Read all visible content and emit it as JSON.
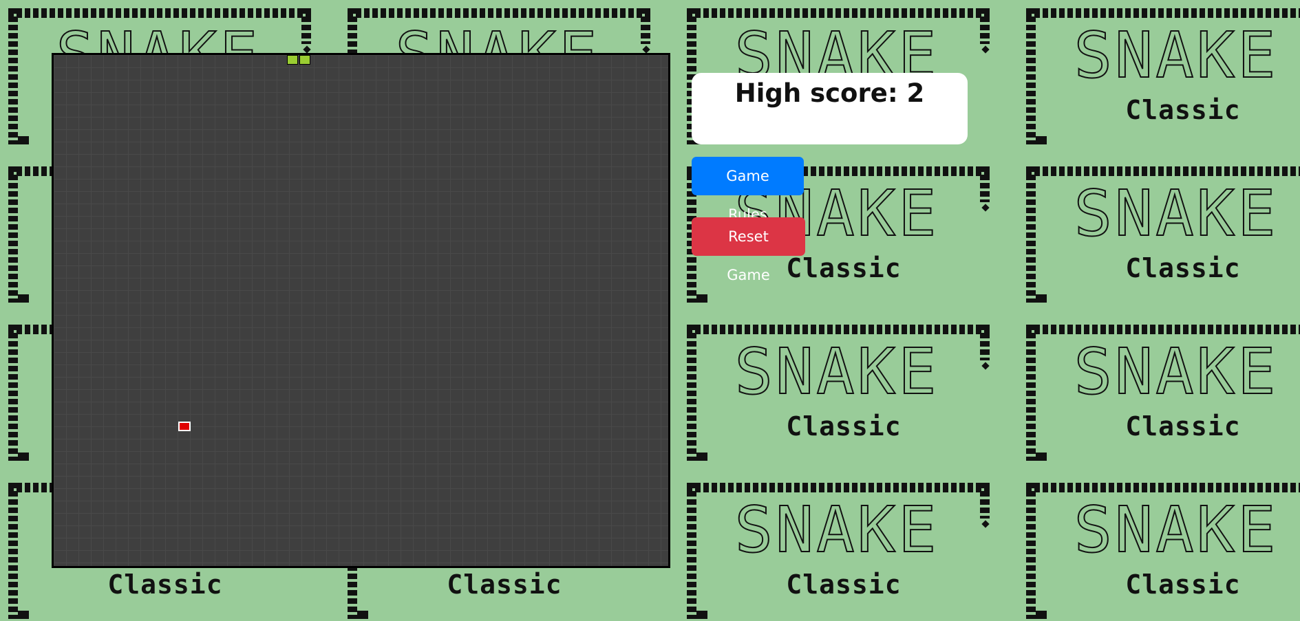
{
  "background": {
    "tile_title": "SNAKE",
    "tile_subtitle": "Classic",
    "tile_color": "#99cc99"
  },
  "game": {
    "grid": {
      "cols": 50,
      "rows": 42
    },
    "snake": [
      {
        "col": 19,
        "row": 0
      },
      {
        "col": 20,
        "row": 0
      }
    ],
    "food": {
      "col": 10,
      "row": 30
    },
    "colors": {
      "board": "#3f3f3f",
      "snake": "#9acd32",
      "food": "#e00000"
    }
  },
  "score_panel": {
    "text": "High score: 2"
  },
  "buttons": {
    "rules_label": "Game Rules",
    "reset_label": "Reset Game"
  }
}
